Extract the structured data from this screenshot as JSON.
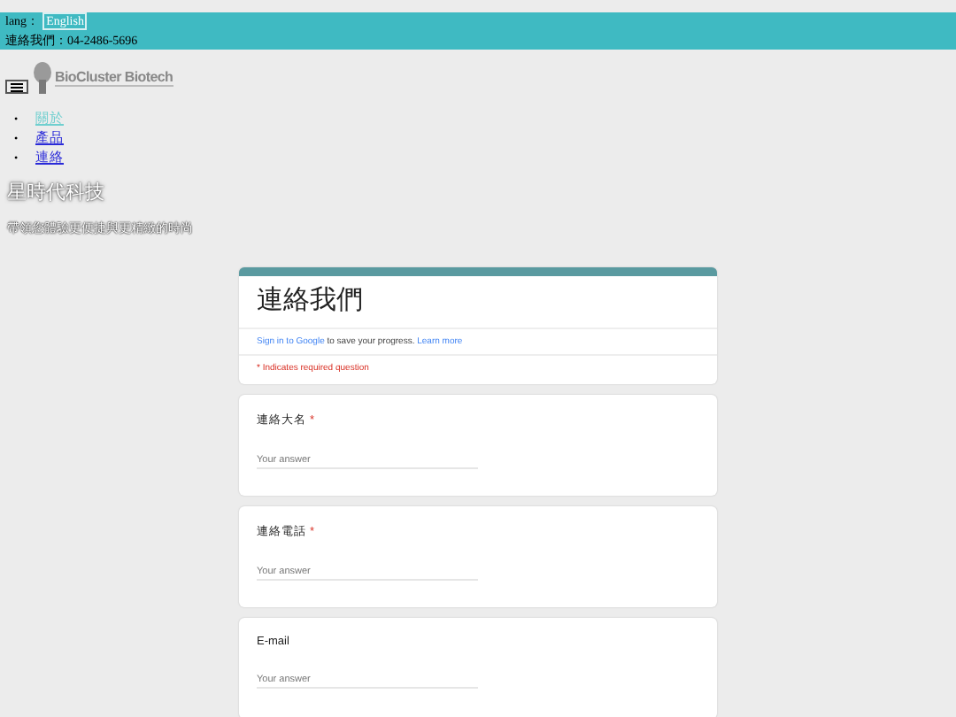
{
  "topbar": {
    "lang_label": "lang：",
    "lang_button": "English",
    "contact": "連絡我們：04-2486-5696"
  },
  "logo": {
    "text": "BioCluster Biotech"
  },
  "nav": [
    {
      "bullet": "•",
      "label": "關於",
      "selected": true
    },
    {
      "bullet": "•",
      "label": "產品",
      "selected": false
    },
    {
      "bullet": "•",
      "label": "連絡",
      "selected": false
    }
  ],
  "hero": {
    "title": "星時代科技",
    "subtitle": "帶領您體驗更便捷與更精緻的時尚"
  },
  "form": {
    "title": "連絡我們",
    "signin_link": "Sign in to Google",
    "signin_text": "to save your progress.",
    "learn_more": "Learn more",
    "required_note": "* Indicates required question",
    "required_symbol": "*",
    "questions": [
      {
        "label": "連絡大名",
        "required": true,
        "placeholder": "Your answer"
      },
      {
        "label": "連絡電話",
        "required": true,
        "placeholder": "Your answer"
      },
      {
        "label": "E-mail",
        "required": false,
        "placeholder": "Your answer"
      }
    ]
  }
}
